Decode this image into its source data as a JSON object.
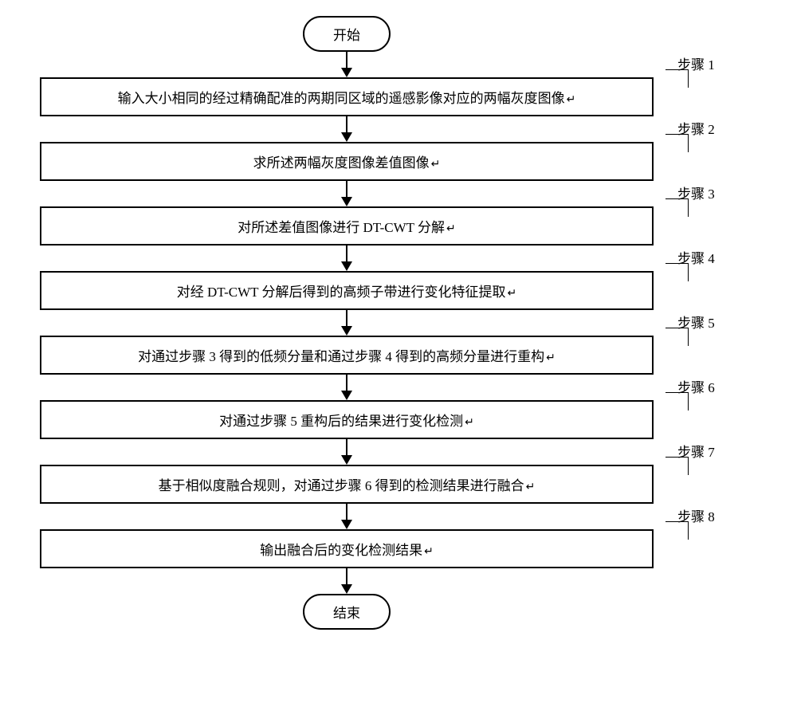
{
  "chart_data": {
    "type": "flowchart",
    "start": "开始",
    "end": "结束",
    "steps": [
      {
        "num": 1,
        "label": "步骤 1",
        "text": "输入大小相同的经过精确配准的两期同区域的遥感影像对应的两幅灰度图像"
      },
      {
        "num": 2,
        "label": "步骤 2",
        "text": "求所述两幅灰度图像差值图像"
      },
      {
        "num": 3,
        "label": "步骤 3",
        "text": "对所述差值图像进行 DT-CWT 分解"
      },
      {
        "num": 4,
        "label": "步骤 4",
        "text": "对经 DT-CWT 分解后得到的高频子带进行变化特征提取"
      },
      {
        "num": 5,
        "label": "步骤 5",
        "text": "对通过步骤 3 得到的低频分量和通过步骤 4 得到的高频分量进行重构"
      },
      {
        "num": 6,
        "label": "步骤 6",
        "text": "对通过步骤 5 重构后的结果进行变化检测"
      },
      {
        "num": 7,
        "label": "步骤 7",
        "text": "基于相似度融合规则，对通过步骤 6 得到的检测结果进行融合"
      },
      {
        "num": 8,
        "label": "步骤 8",
        "text": "输出融合后的变化检测结果"
      }
    ],
    "return_symbol": "↵"
  }
}
